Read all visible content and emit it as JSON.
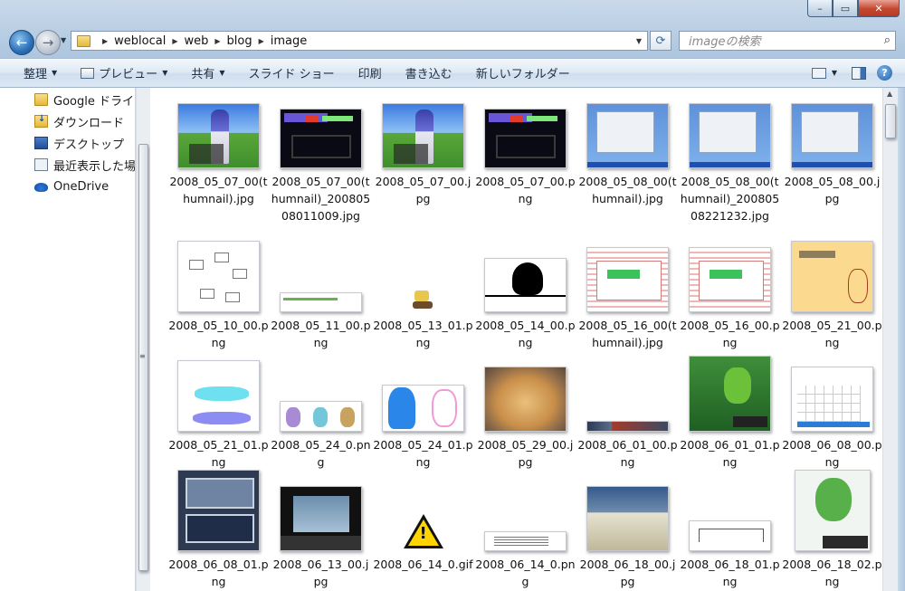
{
  "window": {
    "caption": {
      "minimize": "–",
      "maximize": "▭",
      "close": "✕"
    }
  },
  "address": {
    "crumbs": [
      "weblocal",
      "web",
      "blog",
      "image"
    ]
  },
  "search": {
    "placeholder": "imageの検索"
  },
  "toolbar": {
    "organize": "整理",
    "preview": "プレビュー",
    "share": "共有",
    "slideshow": "スライド ショー",
    "print": "印刷",
    "burn": "書き込む",
    "new_folder": "新しいフォルダー",
    "help": "?"
  },
  "navpane": {
    "items": [
      {
        "label": "Google ドライブ",
        "icon": "folder-icon"
      },
      {
        "label": "ダウンロード",
        "icon": "download-icon"
      },
      {
        "label": "デスクトップ",
        "icon": "desktop-icon"
      },
      {
        "label": "最近表示した場所",
        "icon": "recent-places-icon"
      },
      {
        "label": "OneDrive",
        "icon": "onedrive-icon"
      }
    ]
  },
  "files": [
    {
      "name": "2008_05_07_00(thumnail).jpg"
    },
    {
      "name": "2008_05_07_00(thumnail)_20080508011009.jpg"
    },
    {
      "name": "2008_05_07_00.jpg"
    },
    {
      "name": "2008_05_07_00.png"
    },
    {
      "name": "2008_05_08_00(thumnail).jpg"
    },
    {
      "name": "2008_05_08_00(thumnail)_20080508221232.jpg"
    },
    {
      "name": "2008_05_08_00.jpg"
    },
    {
      "name": "2008_05_10_00.png"
    },
    {
      "name": "2008_05_11_00.png"
    },
    {
      "name": "2008_05_13_01.png"
    },
    {
      "name": "2008_05_14_00.png"
    },
    {
      "name": "2008_05_16_00(thumnail).jpg"
    },
    {
      "name": "2008_05_16_00.png"
    },
    {
      "name": "2008_05_21_00.png"
    },
    {
      "name": "2008_05_21_01.png"
    },
    {
      "name": "2008_05_24_0.png"
    },
    {
      "name": "2008_05_24_01.png"
    },
    {
      "name": "2008_05_29_00.jpg"
    },
    {
      "name": "2008_06_01_00.png"
    },
    {
      "name": "2008_06_01_01.png"
    },
    {
      "name": "2008_06_08_00.png"
    },
    {
      "name": "2008_06_08_01.png"
    },
    {
      "name": "2008_06_13_00.jpg"
    },
    {
      "name": "2008_06_14_0.gif"
    },
    {
      "name": "2008_06_14_0.png"
    },
    {
      "name": "2008_06_18_00.jpg"
    },
    {
      "name": "2008_06_18_01.png"
    },
    {
      "name": "2008_06_18_02.png"
    }
  ]
}
